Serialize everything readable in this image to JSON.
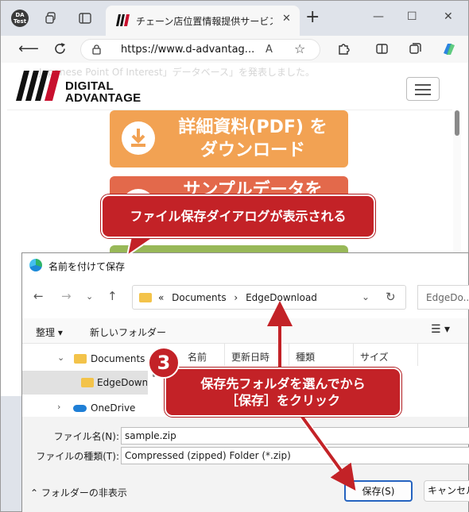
{
  "browser": {
    "profile_label": "DA Test",
    "tab_title": "チェーン店位置情報提供サービス（G",
    "tab_close": "✕",
    "new_tab": "+",
    "url": "https://www.d-advantag...",
    "read_aloud": "A",
    "minimize": "—",
    "maximize": "☐",
    "close": "✕"
  },
  "page": {
    "background_text": "Japanese Point Of Interest」データベース」を発表しました。",
    "logo_line1": "DIGITAL",
    "logo_line2": "ADVANTAGE",
    "cta1_line1": "詳細資料(PDF) を",
    "cta1_line2": "ダウンロード",
    "cta2_line1": "サンプルデータを"
  },
  "callouts": {
    "dialog_shown": "ファイル保存ダイアログが表示される",
    "step_number": "3",
    "choose_folder_line1": "保存先フォルダを選んでから",
    "choose_folder_line2": "［保存］をクリック"
  },
  "dialog": {
    "title": "名前を付けて保存",
    "path_prefix": "«",
    "path_parts": [
      "Documents",
      "EdgeDownload"
    ],
    "path_sep": "›",
    "search_placeholder": "EdgeDo...",
    "organize": "整理 ▾",
    "new_folder": "新しいフォルダー",
    "tree": [
      {
        "label": "Documents"
      },
      {
        "label": "EdgeDownload"
      },
      {
        "label": "OneDrive"
      }
    ],
    "columns": [
      "名前",
      "更新日時",
      "種類",
      "サイズ"
    ],
    "filename_label": "ファイル名(N):",
    "filename_value": "sample.zip",
    "filetype_label": "ファイルの種類(T):",
    "filetype_value": "Compressed (zipped) Folder (*.zip)",
    "hide_folders": "フォルダーの非表示",
    "save_button": "保存(S)",
    "cancel_button": "キャンセル"
  },
  "colors": {
    "callout_red": "#c32227",
    "cta_orange": "#f2a253",
    "cta_red": "#e3694b",
    "cta_green": "#98b858",
    "save_border": "#2563c0"
  }
}
